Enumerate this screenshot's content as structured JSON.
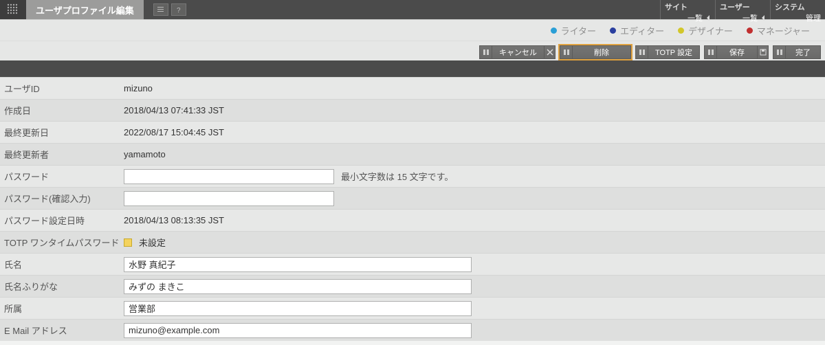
{
  "topbar": {
    "tab_title": "ユーザプロファイル編集",
    "menu": [
      {
        "title": "サイト",
        "sub": "一覧"
      },
      {
        "title": "ユーザー",
        "sub": "一覧"
      },
      {
        "title": "システム",
        "sub": "管理"
      }
    ]
  },
  "legend": {
    "items": [
      {
        "label": "ライター",
        "color": "#2a9fd6"
      },
      {
        "label": "エディター",
        "color": "#2a3f9f"
      },
      {
        "label": "デザイナー",
        "color": "#d2c72a"
      },
      {
        "label": "マネージャー",
        "color": "#c12f2f"
      }
    ]
  },
  "actions": {
    "cancel": "キャンセル",
    "delete": "削除",
    "totp": "TOTP 設定",
    "save": "保存",
    "done": "完了"
  },
  "form": {
    "user_id": {
      "label": "ユーザID",
      "value": "mizuno"
    },
    "created": {
      "label": "作成日",
      "value": "2018/04/13 07:41:33 JST"
    },
    "updated": {
      "label": "最終更新日",
      "value": "2022/08/17 15:04:45 JST"
    },
    "updater": {
      "label": "最終更新者",
      "value": "yamamoto"
    },
    "password": {
      "label": "パスワード",
      "value": "",
      "hint": "最小文字数は 15 文字です。"
    },
    "password_confirm": {
      "label": "パスワード(確認入力)",
      "value": ""
    },
    "password_set_at": {
      "label": "パスワード設定日時",
      "value": "2018/04/13 08:13:35 JST"
    },
    "totp": {
      "label": "TOTP ワンタイムパスワード",
      "value": "未設定"
    },
    "name": {
      "label": "氏名",
      "value": "水野 真紀子"
    },
    "kana": {
      "label": "氏名ふりがな",
      "value": "みずの まきこ"
    },
    "dept": {
      "label": "所属",
      "value": "営業部"
    },
    "email": {
      "label": "E Mail アドレス",
      "value": "mizuno@example.com"
    }
  }
}
